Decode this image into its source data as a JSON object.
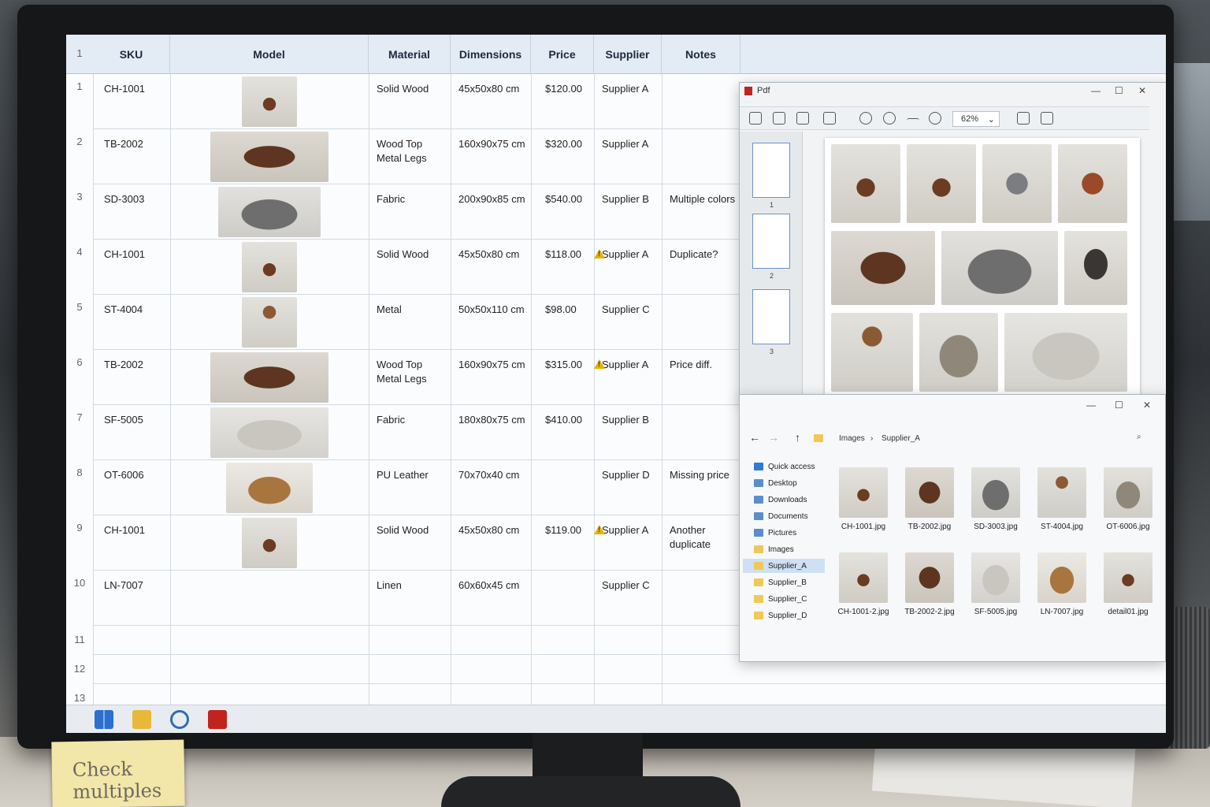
{
  "sheet": {
    "header_row_number": "1",
    "columns": [
      "SKU",
      "Model",
      "Material",
      "Dimensions",
      "Price",
      "Supplier",
      "Notes"
    ],
    "rows": [
      {
        "num": "1",
        "sku": "CH-1001",
        "material": "Solid Wood",
        "dimensions": "45x50x80 cm",
        "price": "$120.00",
        "supplier": "Supplier A",
        "notes": "",
        "img": "chair",
        "warn": false
      },
      {
        "num": "2",
        "sku": "TB-2002",
        "material": "Wood Top\nMetal Legs",
        "dimensions": "160x90x75 cm",
        "price": "$320.00",
        "supplier": "Supplier A",
        "notes": "",
        "img": "table",
        "warn": false
      },
      {
        "num": "3",
        "sku": "SD-3003",
        "material": "Fabric",
        "dimensions": "200x90x85 cm",
        "price": "$540.00",
        "supplier": "Supplier B",
        "notes": "Multiple colors",
        "img": "sofa",
        "warn": false
      },
      {
        "num": "4",
        "sku": "CH-1001",
        "material": "Solid Wood",
        "dimensions": "45x50x80 cm",
        "price": "$118.00",
        "supplier": "Supplier A",
        "notes": "Duplicate?",
        "img": "chair",
        "warn": true
      },
      {
        "num": "5",
        "sku": "ST-4004",
        "material": "Metal",
        "dimensions": "50x50x110 cm",
        "price": "$98.00",
        "supplier": "Supplier C",
        "notes": "",
        "img": "stool",
        "warn": false
      },
      {
        "num": "6",
        "sku": "TB-2002",
        "material": "Wood Top\nMetal Legs",
        "dimensions": "160x90x75 cm",
        "price": "$315.00",
        "supplier": "Supplier A",
        "notes": "Price diff.",
        "img": "table",
        "warn": true
      },
      {
        "num": "7",
        "sku": "SF-5005",
        "material": "Fabric",
        "dimensions": "180x80x75 cm",
        "price": "$410.00",
        "supplier": "Supplier B",
        "notes": "",
        "img": "sofa-light",
        "warn": false
      },
      {
        "num": "8",
        "sku": "OT-6006",
        "material": "PU Leather",
        "dimensions": "70x70x40 cm",
        "price": "",
        "supplier": "Supplier D",
        "notes": "Missing price",
        "img": "ottoman",
        "warn": false
      },
      {
        "num": "9",
        "sku": "CH-1001",
        "material": "Solid Wood",
        "dimensions": "45x50x80 cm",
        "price": "$119.00",
        "supplier": "Supplier A",
        "notes": "Another\nduplicate",
        "img": "chair",
        "warn": true
      },
      {
        "num": "10",
        "sku": "LN-7007",
        "material": "Linen",
        "dimensions": "60x60x45 cm",
        "price": "",
        "supplier": "Supplier C",
        "notes": "",
        "img": "",
        "warn": false
      }
    ],
    "empty_rows": [
      "11",
      "12",
      "13"
    ]
  },
  "pdf": {
    "title": "Pdf",
    "zoom": "62%",
    "pages": [
      "1",
      "2",
      "3"
    ]
  },
  "explorer": {
    "breadcrumb": [
      "Images",
      "Supplier_A"
    ],
    "nav": [
      "Quick access",
      "Desktop",
      "Downloads",
      "Documents",
      "Pictures",
      "Images",
      "Supplier_A",
      "Supplier_B",
      "Supplier_C",
      "Supplier_D"
    ],
    "selected_nav": "Supplier_A",
    "files": [
      {
        "name": "CH-1001.jpg",
        "img": "chair"
      },
      {
        "name": "TB-2002.jpg",
        "img": "table"
      },
      {
        "name": "SD-3003.jpg",
        "img": "sofa"
      },
      {
        "name": "ST-4004.jpg",
        "img": "stool"
      },
      {
        "name": "OT-6006.jpg",
        "img": "ottoman-grey"
      },
      {
        "name": "CH-1001-2.jpg",
        "img": "chair"
      },
      {
        "name": "TB-2002-2.jpg",
        "img": "table"
      },
      {
        "name": "SF-5005.jpg",
        "img": "sofa-light"
      },
      {
        "name": "LN-7007.jpg",
        "img": "ottoman"
      },
      {
        "name": "detail01.jpg",
        "img": "chair"
      }
    ]
  },
  "sticky_note": "Check\nmultiples"
}
